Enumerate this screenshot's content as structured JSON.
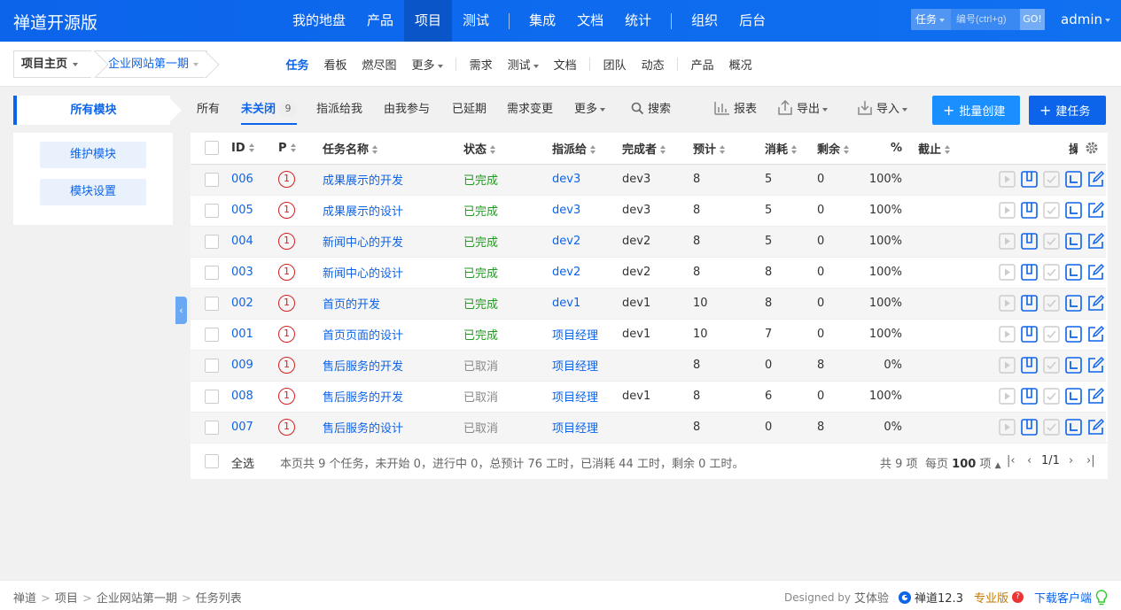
{
  "app": {
    "brand": "禅道开源版",
    "user": "admin"
  },
  "mainnav": [
    "我的地盘",
    "产品",
    "项目",
    "测试",
    "集成",
    "文档",
    "统计",
    "组织",
    "后台"
  ],
  "search": {
    "type": "任务",
    "placeholder": "编号(ctrl+g)",
    "go": "GO!"
  },
  "breadcrumb": {
    "home": "项目主页",
    "project": "企业网站第一期"
  },
  "subnav": [
    "任务",
    "看板",
    "燃尽图",
    "更多",
    "需求",
    "测试",
    "文档",
    "团队",
    "动态",
    "产品",
    "概况"
  ],
  "sidebar": {
    "tab": "所有模块",
    "btn1": "维护模块",
    "btn2": "模块设置"
  },
  "filters": {
    "all": "所有",
    "unclosed": "未关闭",
    "unclosed_count": "9",
    "assigned": "指派给我",
    "involved": "由我参与",
    "delayed": "已延期",
    "changed": "需求变更",
    "more": "更多",
    "search": "搜索",
    "report": "报表",
    "export": "导出",
    "import": "导入",
    "batch": "批量创建",
    "create": "建任务"
  },
  "columns": {
    "id": "ID",
    "pri": "P",
    "name": "任务名称",
    "status": "状态",
    "assigned": "指派给",
    "finisher": "完成者",
    "estimate": "预计",
    "consumed": "消耗",
    "left": "剩余",
    "progress": "%",
    "deadline": "截止",
    "actions": "操作"
  },
  "tasks": [
    {
      "id": "006",
      "pri": "1",
      "name": "成果展示的开发",
      "status": "已完成",
      "assigned": "dev3",
      "finisher": "dev3",
      "estimate": "8",
      "consumed": "5",
      "left": "0",
      "progress": "100%"
    },
    {
      "id": "005",
      "pri": "1",
      "name": "成果展示的设计",
      "status": "已完成",
      "assigned": "dev3",
      "finisher": "dev3",
      "estimate": "8",
      "consumed": "5",
      "left": "0",
      "progress": "100%"
    },
    {
      "id": "004",
      "pri": "1",
      "name": "新闻中心的开发",
      "status": "已完成",
      "assigned": "dev2",
      "finisher": "dev2",
      "estimate": "8",
      "consumed": "5",
      "left": "0",
      "progress": "100%"
    },
    {
      "id": "003",
      "pri": "1",
      "name": "新闻中心的设计",
      "status": "已完成",
      "assigned": "dev2",
      "finisher": "dev2",
      "estimate": "8",
      "consumed": "8",
      "left": "0",
      "progress": "100%"
    },
    {
      "id": "002",
      "pri": "1",
      "name": "首页的开发",
      "status": "已完成",
      "assigned": "dev1",
      "finisher": "dev1",
      "estimate": "10",
      "consumed": "8",
      "left": "0",
      "progress": "100%"
    },
    {
      "id": "001",
      "pri": "1",
      "name": "首页页面的设计",
      "status": "已完成",
      "assigned": "项目经理",
      "finisher": "dev1",
      "estimate": "10",
      "consumed": "7",
      "left": "0",
      "progress": "100%"
    },
    {
      "id": "009",
      "pri": "1",
      "name": "售后服务的开发",
      "status": "已取消",
      "assigned": "项目经理",
      "finisher": "",
      "estimate": "8",
      "consumed": "0",
      "left": "8",
      "progress": "0%"
    },
    {
      "id": "008",
      "pri": "1",
      "name": "售后服务的开发",
      "status": "已取消",
      "assigned": "项目经理",
      "finisher": "dev1",
      "estimate": "8",
      "consumed": "6",
      "left": "0",
      "progress": "100%"
    },
    {
      "id": "007",
      "pri": "1",
      "name": "售后服务的设计",
      "status": "已取消",
      "assigned": "项目经理",
      "finisher": "",
      "estimate": "8",
      "consumed": "0",
      "left": "8",
      "progress": "0%"
    }
  ],
  "summary": {
    "select_all": "全选",
    "text": "本页共 9 个任务，未开始 0，进行中 0，总预计 76 工时，已消耗 44 工时，剩余 0 工时。",
    "total": "共 9 项",
    "per_page_label": "每页",
    "per_page": "100",
    "per_page_unit": "项",
    "page": "1/1"
  },
  "footer": {
    "crumbs": [
      "禅道",
      "项目",
      "企业网站第一期",
      "任务列表"
    ],
    "designed_by": "Designed by",
    "designer": "艾体验",
    "version": "禅道12.3",
    "pro": "专业版",
    "download": "下载客户端"
  },
  "colors": {
    "primary": "#0c64eb",
    "done": "#229a22",
    "cancel": "#888888",
    "priority": "#d42020"
  }
}
